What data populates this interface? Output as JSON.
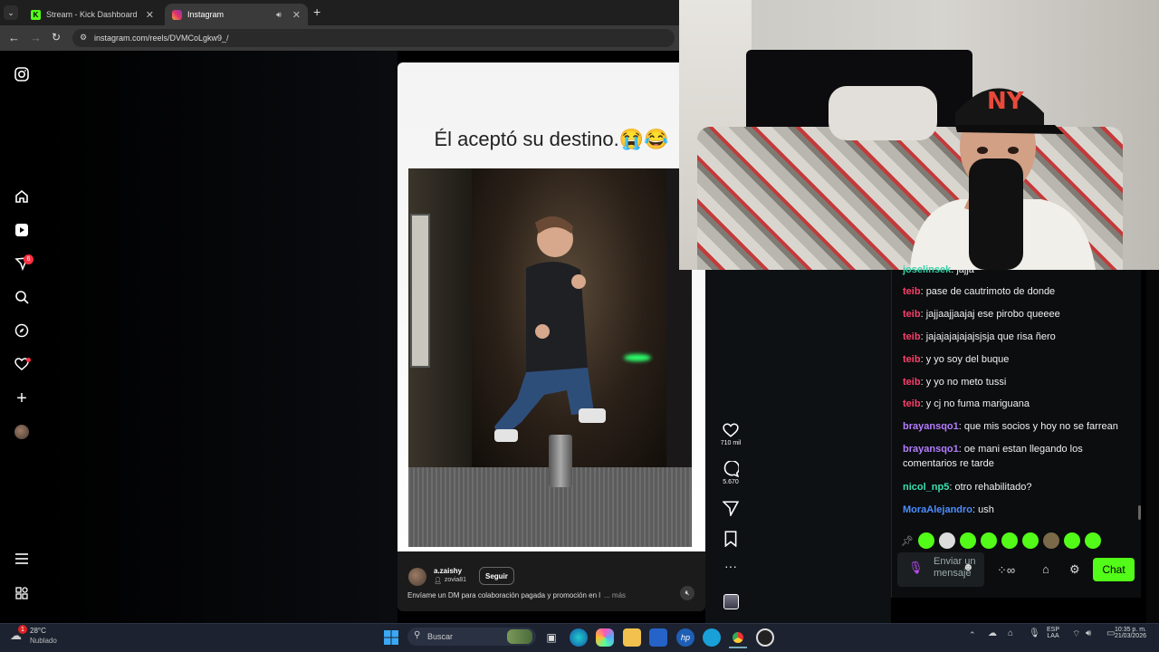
{
  "browser": {
    "tabs": [
      {
        "label": "Stream - Kick Dashboard",
        "close": "✕"
      },
      {
        "label": "Instagram",
        "close": "✕"
      }
    ],
    "new_tab": "+",
    "url": "instagram.com/reels/DVMCoLgkw9_/"
  },
  "sidebar": {
    "notifications_badge": "6"
  },
  "reel": {
    "caption": "Él aceptó su destino.😭😂",
    "author": "a.zaishy",
    "audio": "zovia81",
    "follow": "Seguir",
    "description": "Envíame un DM para colaboración pagada y promoción en l",
    "more": "... más",
    "likes": "710 mil",
    "comments": "5.670"
  },
  "chat": {
    "messages": [
      {
        "user": "joselinsek",
        "text": "jajja",
        "color": "#35d0a8"
      },
      {
        "user": "teib",
        "text": "pase de cautrimoto de donde",
        "color": "#ff3e6c"
      },
      {
        "user": "teib",
        "text": "jajjaajjaajaj ese pirobo queeee",
        "color": "#ff3e6c"
      },
      {
        "user": "teib",
        "text": "jajajajajajajsjsja que risa ñero",
        "color": "#ff3e6c"
      },
      {
        "user": "teib",
        "text": "y yo soy del buque",
        "color": "#ff3e6c"
      },
      {
        "user": "teib",
        "text": "y yo no meto tussi",
        "color": "#ff3e6c"
      },
      {
        "user": "teib",
        "text": "y cj no fuma mariguana",
        "color": "#ff3e6c"
      },
      {
        "user": "brayansqo1",
        "text": "que mis socios y hoy no se farrean",
        "color": "#b57cff"
      },
      {
        "user": "brayansqo1",
        "text": "oe mani estan llegando los comentarios re tarde",
        "color": "#b57cff"
      },
      {
        "user": "nicol_np5",
        "text": "otro rehabilitado?",
        "color": "#3be0b0"
      },
      {
        "user": "MoraAlejandro",
        "text": "ush",
        "color": "#4d8dff"
      }
    ],
    "input_placeholder": "Enviar un mensaje",
    "send_label": "Chat"
  },
  "taskbar": {
    "weather_temp": "28°C",
    "weather_desc": "Nublado",
    "weather_badge": "1",
    "search_placeholder": "Buscar",
    "lang": "ESP",
    "lang2": "LAA",
    "time": "10:35 p. m.",
    "date": "21/03/2026"
  },
  "colors": {
    "kick_green": "#53fc18",
    "taskbar_bg": "#1c2230"
  }
}
